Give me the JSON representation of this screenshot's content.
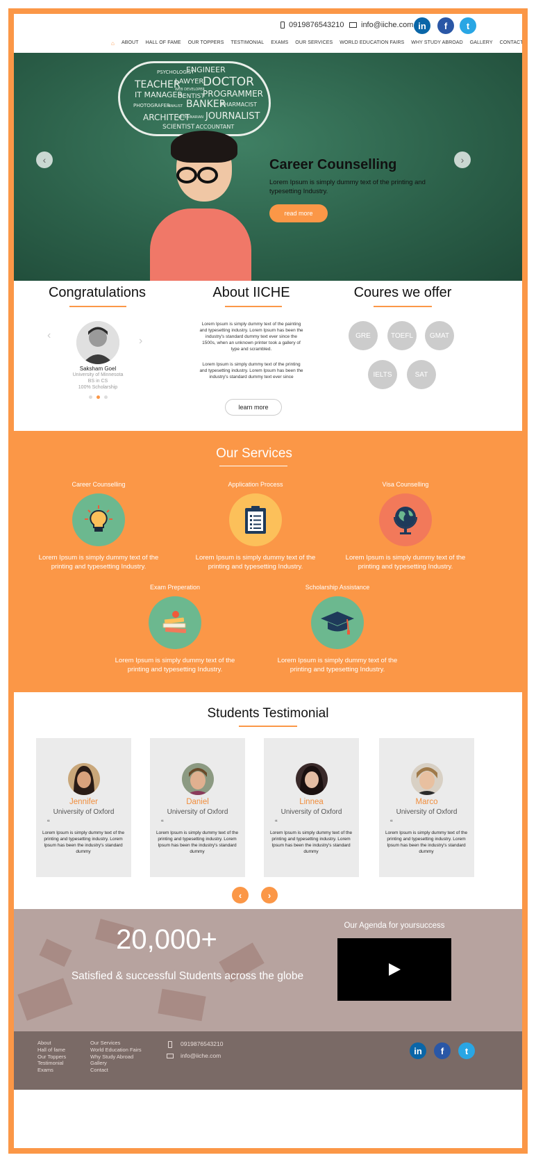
{
  "header": {
    "phone": "0919876543210",
    "email": "info@iiche.com",
    "social": [
      "linkedin-icon",
      "facebook-icon",
      "twitter-icon"
    ],
    "nav": [
      "ABOUT",
      "HALL OF FAME",
      "OUR TOPPERS",
      "TESTIMONIAL",
      "EXAMS",
      "OUR SERVICES",
      "WORLD EDUCATION FAIRS",
      "WHY STUDY ABROAD",
      "GALLERY",
      "CONTACT"
    ]
  },
  "hero": {
    "cloud_words": [
      "PSYCHOLOGIST",
      "ENGINEER",
      "TEACHER",
      "LAWYER",
      "DOCTOR",
      "WEB DEVELOPER",
      "IT MANAGER",
      "DENTIST",
      "PROGRAMMER",
      "PHOTOGRAFER",
      "ANALIST",
      "BANKER",
      "PHARMACIST",
      "ARCHITECT",
      "VETERINARIAN",
      "JOURNALIST",
      "SCIENTIST",
      "ACCOUNTANT"
    ],
    "title": "Career Counselling",
    "text": "Lorem Ipsum is simply dummy text of the printing and  typesetting Industry.",
    "button": "read more"
  },
  "congrats": {
    "title": "Congratulations",
    "name": "Saksham Goel",
    "uni": "University of Minnesota",
    "degree": "BS in CS",
    "scholarship": "100% Scholarship"
  },
  "about": {
    "title": "About IICHE",
    "para1": "Lorem Ipsum is simply dummy text of the painting and typesetting industry. Lorem Ipsum has been the industry's standard dummy text ever since the 1500s, when an unknown printer took a gallery of type and scrambled.",
    "para2": "Lorem Ipsum is simply dummy text of the printing and typesetting industry. Lorem Ipsum has been the industry's standard dummy text ever since",
    "button": "learn more"
  },
  "courses": {
    "title": "Coures we offer",
    "items": [
      "GRE",
      "TOEFL",
      "GMAT",
      "IELTS",
      "SAT"
    ]
  },
  "services": {
    "title": "Our Services",
    "items": [
      {
        "title": "Career Counselling",
        "text": "Lorem Ipsum is simply dummy text of the printing and  typesetting Industry.",
        "icon": "lightbulb-icon",
        "color": "#6cb88f"
      },
      {
        "title": "Application Process",
        "text": "Lorem Ipsum is simply dummy text of the printing and  typesetting Industry.",
        "icon": "clipboard-icon",
        "color": "#fcc05a"
      },
      {
        "title": "Visa Counselling",
        "text": "Lorem Ipsum is simply dummy text of the printing and  typesetting Industry.",
        "icon": "globe-icon",
        "color": "#f2795a"
      },
      {
        "title": "Exam Preperation",
        "text": "Lorem Ipsum is simply dummy text of the printing and  typesetting Industry.",
        "icon": "books-icon",
        "color": "#6cb88f"
      },
      {
        "title": "Scholarship Assistance",
        "text": "Lorem Ipsum is simply dummy text of the printing and  typesetting Industry.",
        "icon": "graduation-cap-icon",
        "color": "#6cb88f"
      }
    ]
  },
  "testimonials": {
    "title": "Students Testimonial",
    "items": [
      {
        "name": "Jennifer",
        "uni": "University of Oxford",
        "text": "Lorem Ipsum is simply dummy text of the printing and typesetting industry. Lorem Ipsum has been the industry's standard dummy"
      },
      {
        "name": "Daniel",
        "uni": "University of Oxford",
        "text": "Lorem Ipsum is simply dummy text of the printing and typesetting industry. Lorem Ipsum has been the industry's standard dummy"
      },
      {
        "name": "Linnea",
        "uni": "University of Oxford",
        "text": "Lorem Ipsum is simply dummy text of the printing and typesetting industry. Lorem Ipsum has been the industry's standard dummy"
      },
      {
        "name": "Marco",
        "uni": "University of Oxford",
        "text": "Lorem Ipsum is simply dummy text of the printing and typesetting industry. Lorem Ipsum has been the industry's standard dummy"
      }
    ]
  },
  "stats": {
    "number": "20,000+",
    "text": "Satisfied & successful Students across the globe",
    "agenda": "Our Agenda for yoursuccess"
  },
  "footer": {
    "col1": [
      "About",
      "Hall of fame",
      "Our Toppers",
      "Testimonial",
      "Exams"
    ],
    "col2": [
      "Our Services",
      "World Education Fairs",
      "Why Study Abroad",
      "Gallery",
      "Contact"
    ],
    "phone": "0919876543210",
    "email": "info@iiche.com"
  },
  "colors": {
    "accent": "#fb9747",
    "hero_bg": "#2c614a",
    "footer_bg": "#7a6a66"
  }
}
